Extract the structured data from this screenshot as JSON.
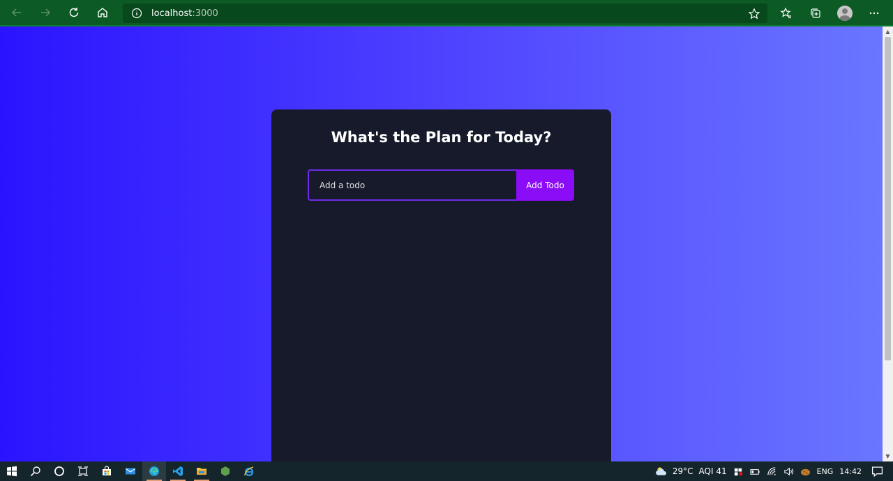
{
  "browser": {
    "url_host": "localhost",
    "url_port": ":3000",
    "nav_icons": [
      "back-arrow-icon",
      "forward-arrow-icon",
      "refresh-icon",
      "home-icon"
    ],
    "tool_icons": [
      "favorites-icon",
      "collections-icon",
      "profile-avatar",
      "more-icon"
    ]
  },
  "app": {
    "title": "What's the Plan for Today?",
    "input_placeholder": "Add a todo",
    "input_value": "",
    "add_button_label": "Add Todo",
    "accent_color": "#8b0cf6",
    "card_color": "#161a2b"
  },
  "taskbar": {
    "apps": [
      "start-icon",
      "search-icon",
      "cortana-icon",
      "task-view-icon",
      "store-icon",
      "mail-icon",
      "edge-icon",
      "vscode-icon",
      "file-explorer-icon",
      "node-icon",
      "ie-icon"
    ],
    "weather": "29°C",
    "aqi": "AQI 41",
    "language": "ENG",
    "time": "14:42"
  }
}
